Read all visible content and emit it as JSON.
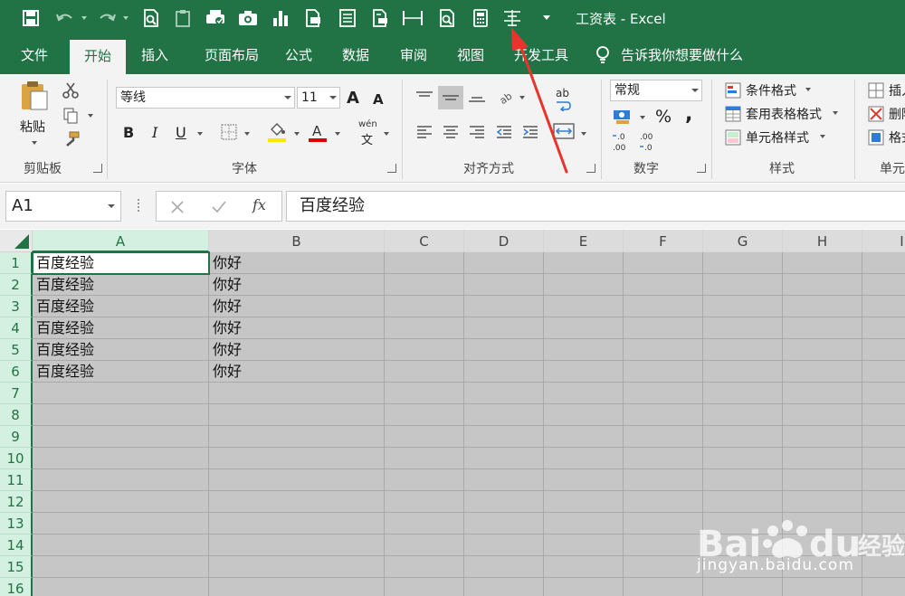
{
  "title_bar": {
    "document_title": "工资表  -  Excel",
    "quick_access": [
      {
        "icon": "save-icon"
      },
      {
        "icon": "undo-icon"
      },
      {
        "icon": "redo-icon"
      },
      {
        "icon": "print-preview-icon"
      },
      {
        "icon": "clipboard-icon"
      },
      {
        "icon": "spelling-icon"
      },
      {
        "icon": "camera-icon"
      },
      {
        "icon": "chart-icon"
      },
      {
        "icon": "print-icon"
      },
      {
        "icon": "form-icon"
      },
      {
        "icon": "print-setup-icon"
      },
      {
        "icon": "page-width-icon"
      },
      {
        "icon": "zoom-page-icon"
      },
      {
        "icon": "calculator-icon"
      },
      {
        "icon": "align-distribute-icon"
      },
      {
        "icon": "customize-qat-icon"
      }
    ]
  },
  "tabs": [
    {
      "label": "文件",
      "active": false
    },
    {
      "label": "开始",
      "active": true
    },
    {
      "label": "插入",
      "active": false
    },
    {
      "label": "页面布局",
      "active": false
    },
    {
      "label": "公式",
      "active": false
    },
    {
      "label": "数据",
      "active": false
    },
    {
      "label": "审阅",
      "active": false
    },
    {
      "label": "视图",
      "active": false
    },
    {
      "label": "开发工具",
      "active": false
    }
  ],
  "tell_me": "告诉我你想要做什么",
  "ribbon": {
    "clipboard": {
      "label": "剪贴板",
      "paste": "粘贴"
    },
    "font": {
      "label": "字体",
      "font_name": "等线",
      "font_size": "11",
      "bold": "B",
      "italic": "I",
      "underline": "U",
      "grow": "A",
      "shrink": "A",
      "phonetic_top": "wén",
      "phonetic_bottom": "文"
    },
    "alignment": {
      "label": "对齐方式",
      "wrap": "ab"
    },
    "number": {
      "label": "数字",
      "format": "常规",
      "percent": "%",
      "comma": ","
    },
    "styles": {
      "label": "样式",
      "conditional": "条件格式",
      "table": "套用表格格式",
      "cell": "单元格样式"
    },
    "cells": {
      "label": "单元",
      "insert": "插入",
      "delete": "删除",
      "format": "格式"
    }
  },
  "formula_bar": {
    "name_box": "A1",
    "fx": "fx",
    "formula": "百度经验"
  },
  "sheet": {
    "columns": [
      "A",
      "B",
      "C",
      "D",
      "E",
      "F",
      "G",
      "H",
      "I"
    ],
    "rows": [
      "1",
      "2",
      "3",
      "4",
      "5",
      "6",
      "7",
      "8",
      "9",
      "10",
      "11",
      "12",
      "13",
      "14",
      "15",
      "16"
    ],
    "col_a": [
      "百度经验",
      "百度经验",
      "百度经验",
      "百度经验",
      "百度经验",
      "百度经验"
    ],
    "col_b": [
      "你好",
      "你好",
      "你好",
      "你好",
      "你好",
      "你好"
    ]
  },
  "watermark": {
    "brand": "Bai du 经验",
    "url": "jingyan.baidu.com"
  },
  "colors": {
    "excel_green": "#217346",
    "annotation_arrow": "#e8342c"
  }
}
